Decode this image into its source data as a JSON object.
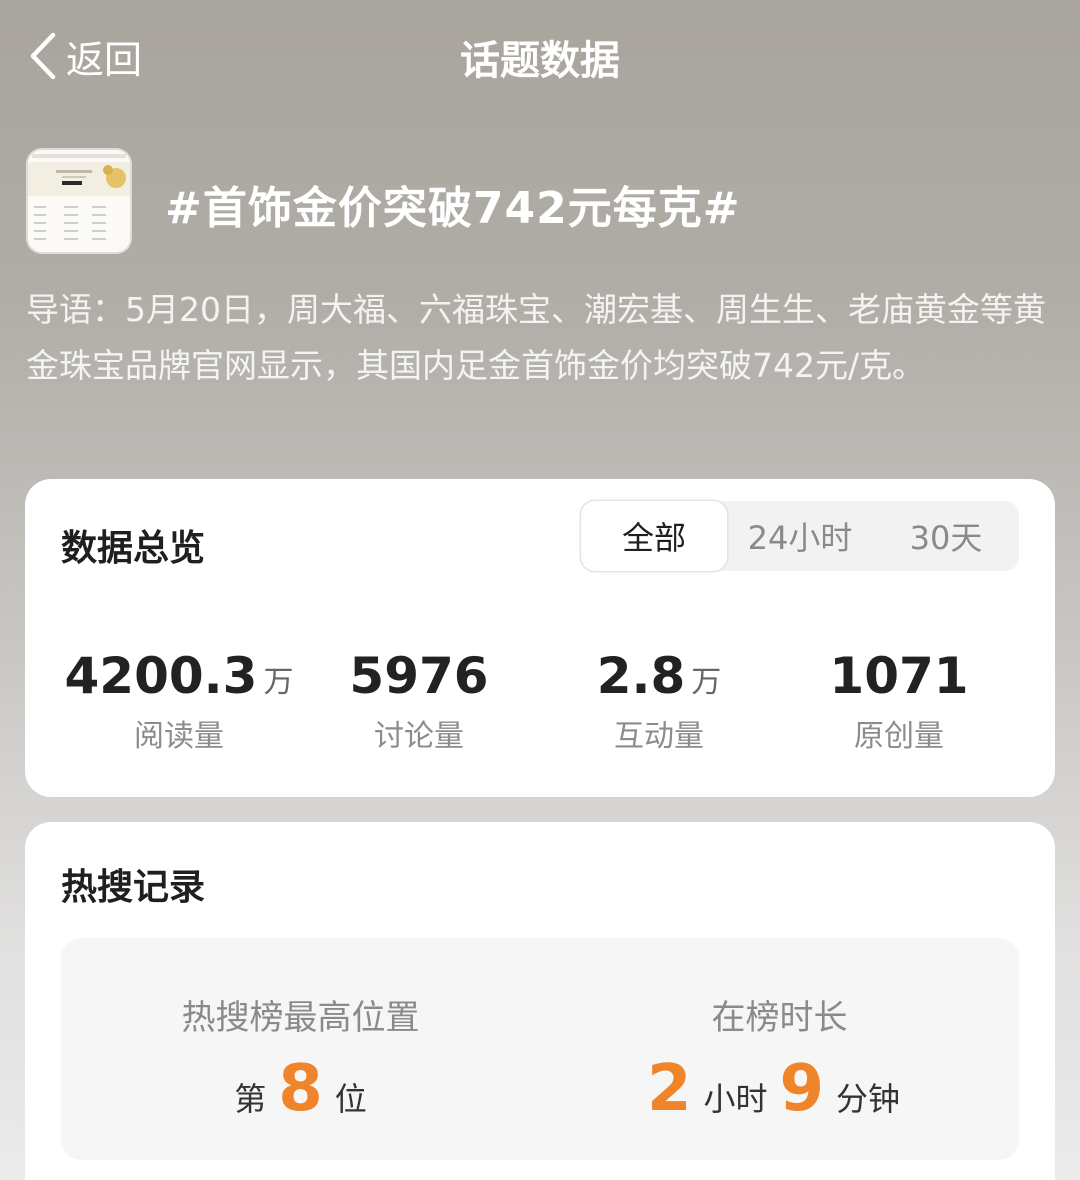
{
  "header": {
    "back_label": "返回",
    "title": "话题数据"
  },
  "topic": {
    "title": "#首饰金价突破742元每克#",
    "intro": "导语：5月20日，周大福、六福珠宝、潮宏基、周生生、老庙黄金等黄金珠宝品牌官网显示，其国内足金首饰金价均突破742元/克。"
  },
  "overview": {
    "title": "数据总览",
    "tabs": [
      {
        "label": "全部",
        "active": true
      },
      {
        "label": "24小时",
        "active": false
      },
      {
        "label": "30天",
        "active": false
      }
    ],
    "stats": [
      {
        "value": "4200.3",
        "unit": "万",
        "label": "阅读量"
      },
      {
        "value": "5976",
        "unit": "",
        "label": "讨论量"
      },
      {
        "value": "2.8",
        "unit": "万",
        "label": "互动量"
      },
      {
        "value": "1071",
        "unit": "",
        "label": "原创量"
      }
    ]
  },
  "hot_search": {
    "title": "热搜记录",
    "peak": {
      "label": "热搜榜最高位置",
      "prefix": "第",
      "rank": "8",
      "suffix": "位"
    },
    "duration": {
      "label": "在榜时长",
      "hours": "2",
      "hours_unit": "小时",
      "minutes": "9",
      "minutes_unit": "分钟"
    }
  },
  "colors": {
    "accent_orange": "#f0842a",
    "header_text": "#ffffff"
  }
}
